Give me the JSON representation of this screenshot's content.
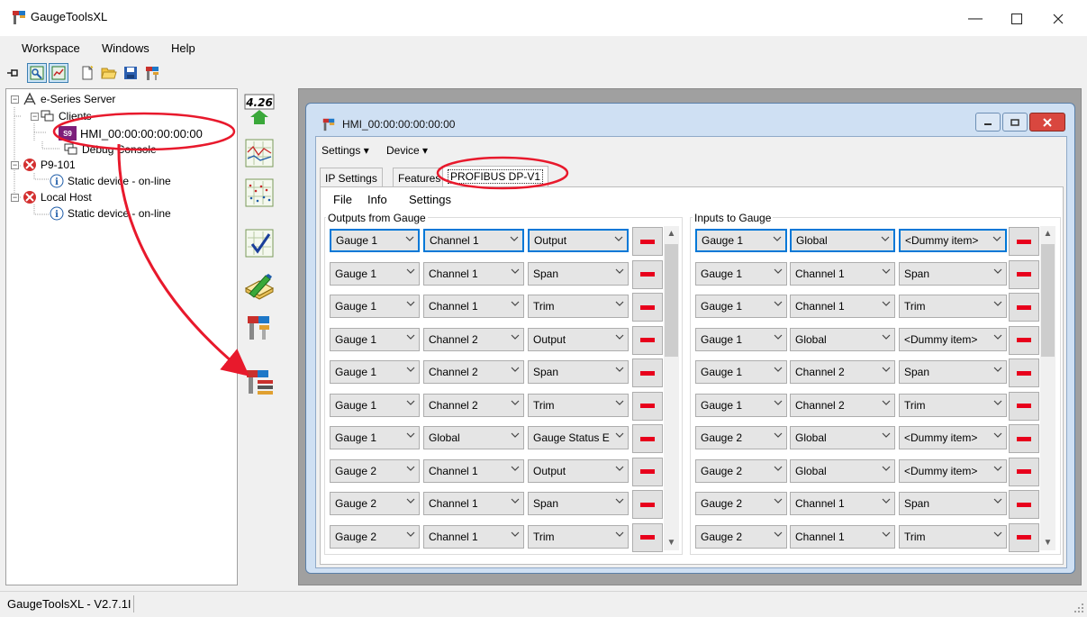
{
  "window": {
    "title": "GaugeToolsXL"
  },
  "menubar": {
    "items": [
      "Workspace",
      "Windows",
      "Help"
    ]
  },
  "tree": {
    "server": "e-Series Server",
    "clients": "Clients",
    "hmi": "HMI_00:00:00:00:00:00",
    "debug": "Debug Console",
    "p9": "P9-101",
    "p9_static": "Static device - on-line",
    "localhost": "Local Host",
    "local_static": "Static device - on-line",
    "hmi_badge": "S9"
  },
  "iconcol": {
    "version_badge": "4.26"
  },
  "hmi_window": {
    "title": "HMI_00:00:00:00:00:00",
    "menus": [
      "Settings",
      "Device"
    ],
    "tabs": [
      "IP Settings",
      "Features",
      "PROFIBUS DP-V1"
    ],
    "panel_menus": [
      "File",
      "Info",
      "Settings"
    ]
  },
  "outputs": {
    "title": "Outputs from Gauge",
    "rows": [
      [
        "Gauge 1",
        "Channel 1",
        "Output"
      ],
      [
        "Gauge 1",
        "Channel 1",
        "Span"
      ],
      [
        "Gauge 1",
        "Channel 1",
        "Trim"
      ],
      [
        "Gauge 1",
        "Channel 2",
        "Output"
      ],
      [
        "Gauge 1",
        "Channel 2",
        "Span"
      ],
      [
        "Gauge 1",
        "Channel 2",
        "Trim"
      ],
      [
        "Gauge 1",
        "Global",
        "Gauge Status E"
      ],
      [
        "Gauge 2",
        "Channel 1",
        "Output"
      ],
      [
        "Gauge 2",
        "Channel 1",
        "Span"
      ],
      [
        "Gauge 2",
        "Channel 1",
        "Trim"
      ]
    ]
  },
  "inputs": {
    "title": "Inputs to Gauge",
    "rows": [
      [
        "Gauge 1",
        "Global",
        "<Dummy item>"
      ],
      [
        "Gauge 1",
        "Channel 1",
        "Span"
      ],
      [
        "Gauge 1",
        "Channel 1",
        "Trim"
      ],
      [
        "Gauge 1",
        "Global",
        "<Dummy item>"
      ],
      [
        "Gauge 1",
        "Channel 2",
        "Span"
      ],
      [
        "Gauge 1",
        "Channel 2",
        "Trim"
      ],
      [
        "Gauge 2",
        "Global",
        "<Dummy item>"
      ],
      [
        "Gauge 2",
        "Global",
        "<Dummy item>"
      ],
      [
        "Gauge 2",
        "Channel 1",
        "Span"
      ],
      [
        "Gauge 2",
        "Channel 1",
        "Trim"
      ]
    ]
  },
  "statusbar": {
    "text": "GaugeToolsXL - V2.7.1I"
  },
  "colors": {
    "annotation": "#e8192c",
    "remove": "#e8001c",
    "selection": "#0078d7"
  }
}
